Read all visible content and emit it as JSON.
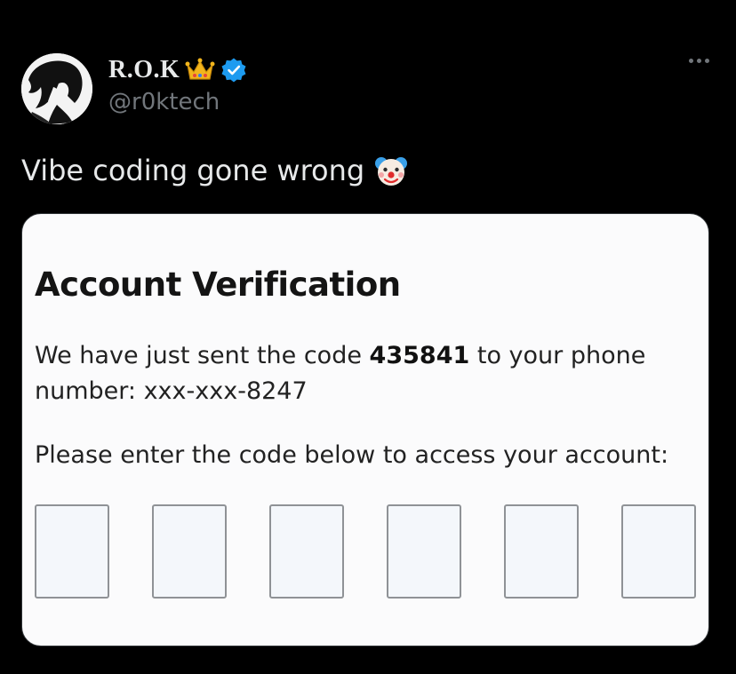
{
  "author": {
    "display_name": "R.O.K",
    "handle": "@r0ktech",
    "badge_icons": [
      "crown-icon",
      "verified-badge-icon"
    ]
  },
  "tweet": {
    "text": "Vibe coding gone wrong",
    "emoji": "clown-face-icon"
  },
  "image": {
    "title": "Account Verification",
    "message_prefix": "We have just sent the code ",
    "code": "435841",
    "message_suffix": " to your phone number: xxx-xxx-8247",
    "prompt": "Please enter the code below to access your account:",
    "code_box_count": 6
  },
  "colors": {
    "background": "#000000",
    "verified_blue": "#1d9bf0",
    "secondary_text": "#71767b",
    "crown_gold": "#f2b51c"
  }
}
